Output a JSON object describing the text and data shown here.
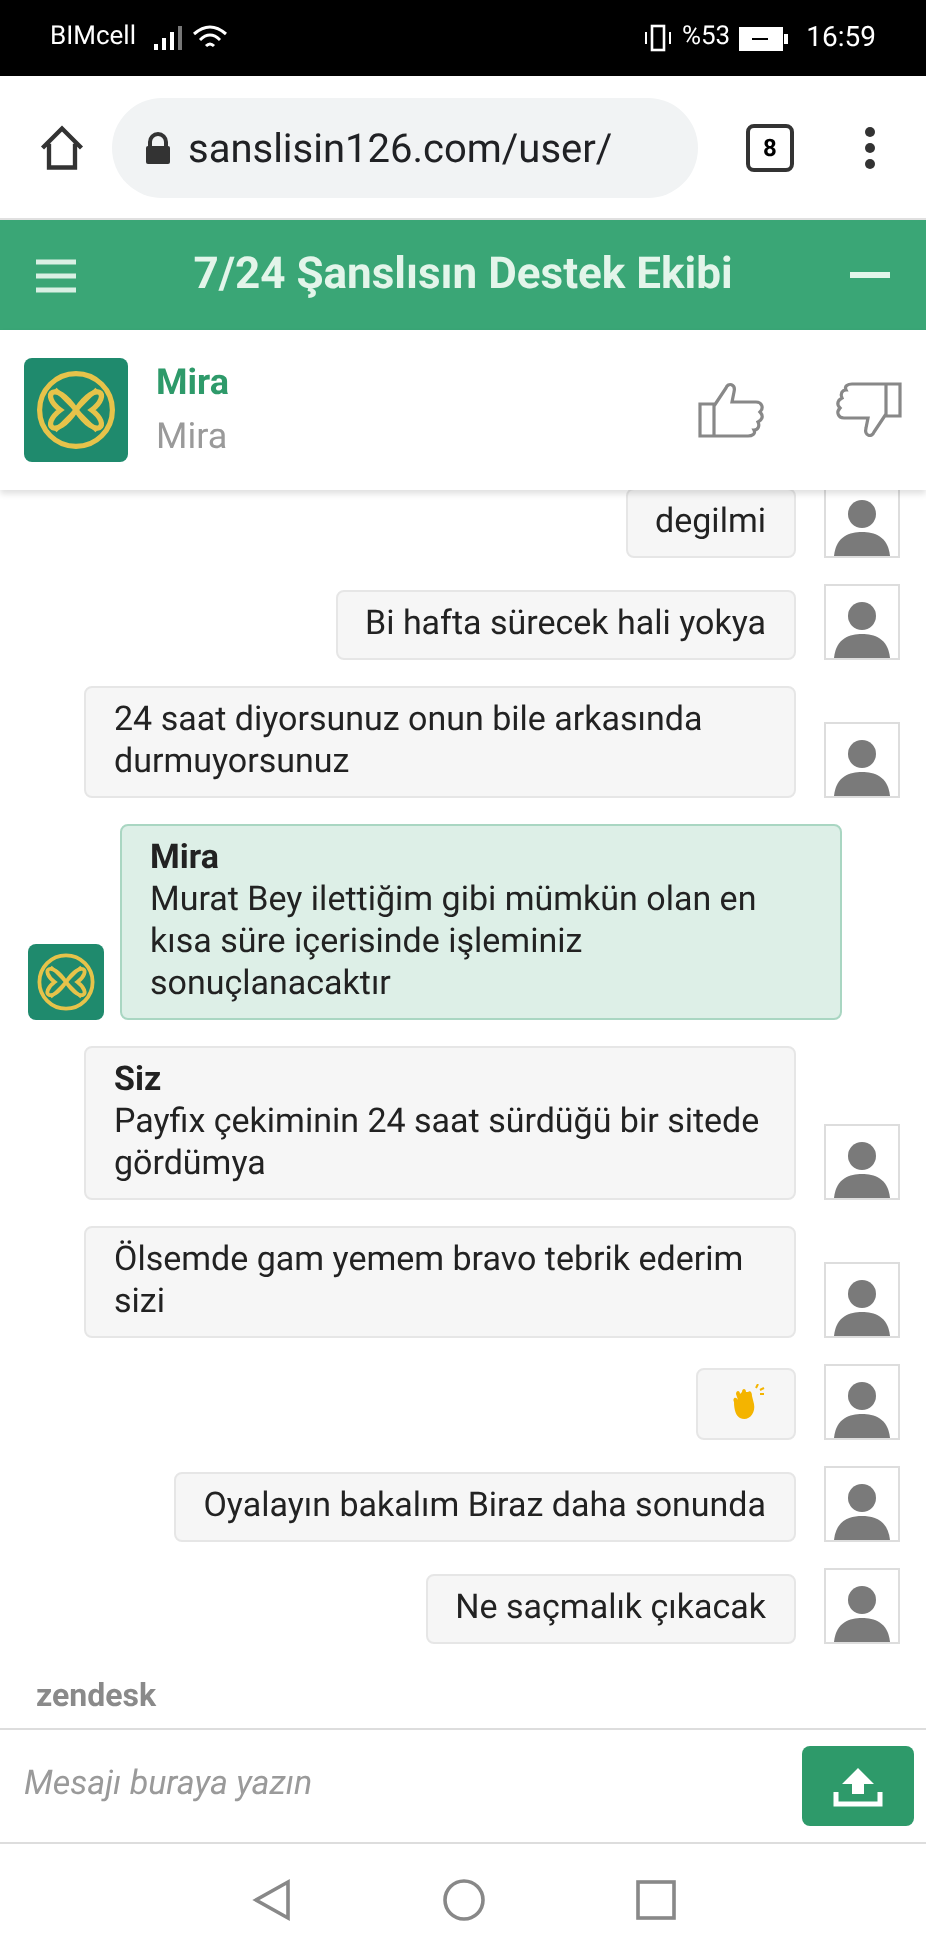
{
  "status_bar": {
    "carrier": "BIMcell",
    "battery": "%53",
    "time": "16:59"
  },
  "browser": {
    "url": "sanslisin126.com/user/",
    "tab_count": "8"
  },
  "header": {
    "title": "7/24 Şanslısın Destek Ekibi"
  },
  "agent": {
    "name": "Mira",
    "subtitle": "Mira"
  },
  "messages": [
    {
      "kind": "visitor",
      "text": "degilmi"
    },
    {
      "kind": "visitor",
      "text": "Bi hafta sürecek hali yokya"
    },
    {
      "kind": "visitor",
      "text": "24 saat diyorsunuz onun bile arkasında durmuyorsunuz"
    },
    {
      "kind": "agent",
      "sender": "Mira",
      "text": "Murat Bey ilettiğim gibi mümkün olan en kısa süre içerisinde işleminiz sonuçlanacaktır"
    },
    {
      "kind": "visitor",
      "sender": "Siz",
      "text": "Payfix çekiminin 24 saat sürdüğü bir sitede gördümya"
    },
    {
      "kind": "visitor",
      "text": "Ölsemde gam yemem bravo tebrik ederim sizi"
    },
    {
      "kind": "clap"
    },
    {
      "kind": "visitor",
      "text": "Oyalayın bakalım Biraz daha sonunda"
    },
    {
      "kind": "visitor",
      "text": "Ne saçmalık çıkacak"
    }
  ],
  "branding": "zendesk",
  "composer": {
    "placeholder": "Mesajı buraya yazın"
  }
}
